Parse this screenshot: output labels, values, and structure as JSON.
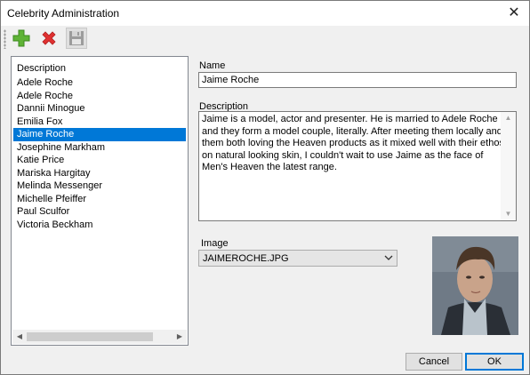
{
  "window": {
    "title": "Celebrity Administration"
  },
  "titlebar": {
    "close_glyph": "✕"
  },
  "toolbar": {
    "add_icon": "plus-icon",
    "add_color": "#5fb336",
    "delete_icon": "x-icon",
    "delete_color": "#e03131",
    "save_icon": "floppy-disk-icon",
    "save_color": "#9c9c9c"
  },
  "list": {
    "header": "Description",
    "items": [
      "Adele Roche",
      "Adele Roche",
      "Dannii Minogue",
      "Emilia Fox",
      "Jaime Roche",
      "Josephine Markham",
      "Katie Price",
      "Mariska Hargitay",
      "Melinda Messenger",
      "Michelle Pfeiffer",
      "Paul Sculfor",
      "Victoria Beckham"
    ],
    "selected_index": 4,
    "selected_color": "#0078d7"
  },
  "form": {
    "name_label": "Name",
    "name_value": "Jaime Roche",
    "description_label": "Description",
    "description_value": "Jaime is a model, actor and presenter. He is married to Adele Roche and they form a model couple, literally. After meeting them locally and them both loving the Heaven products as it mixed well with their ethos on natural looking skin, I couldn't wait to use Jaime as the face of Men's Heaven the latest range.",
    "image_label": "Image",
    "image_value": "JAIMEROCHE.JPG"
  },
  "buttons": {
    "cancel": "Cancel",
    "ok": "OK"
  }
}
